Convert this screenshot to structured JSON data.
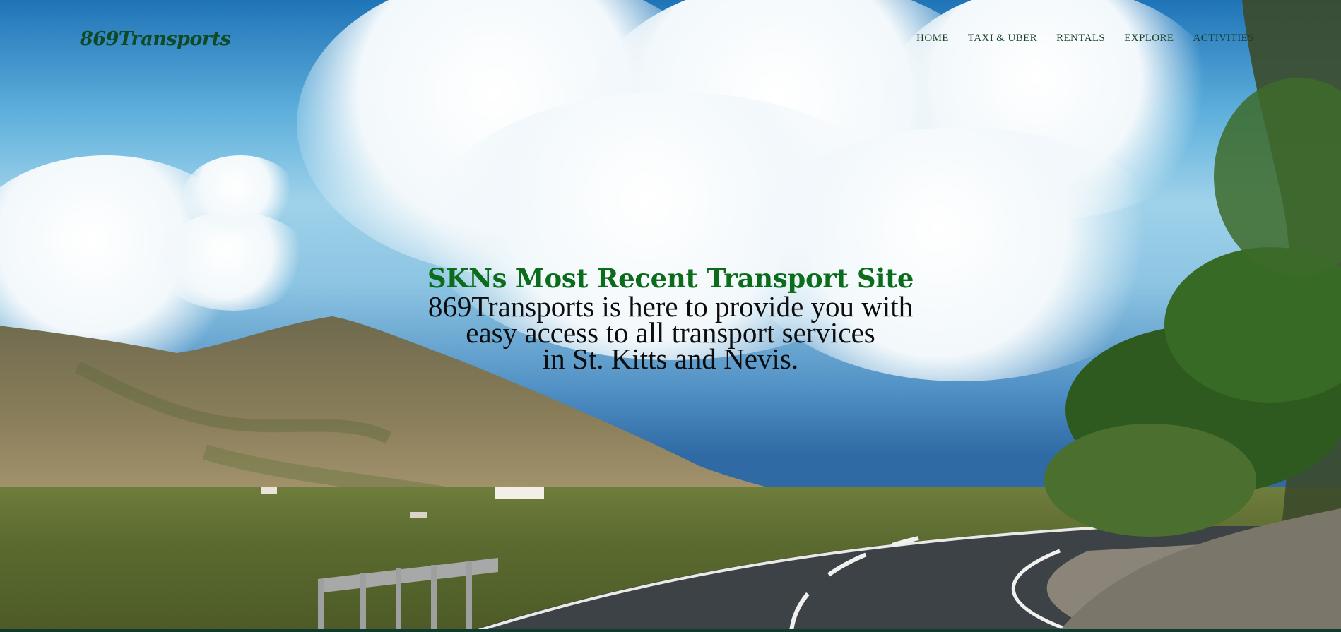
{
  "site": {
    "logo": "869Transports"
  },
  "nav": {
    "items": [
      {
        "label": "HOME"
      },
      {
        "label": "TAXI & UBER"
      },
      {
        "label": "RENTALS"
      },
      {
        "label": "EXPLORE"
      },
      {
        "label": "ACTIVITIES"
      }
    ]
  },
  "hero": {
    "title": "SKNs Most Recent Transport Site",
    "lines": [
      "869Transports is here to provide you with",
      "easy access to all transport services",
      "in St. Kitts and Nevis."
    ],
    "image": "scenic-road-mountain-sky"
  },
  "colors": {
    "logo": "#0f4a24",
    "title": "#0b6d1c",
    "nav": "#173d22",
    "footer_bar": "#0e3b2e"
  }
}
